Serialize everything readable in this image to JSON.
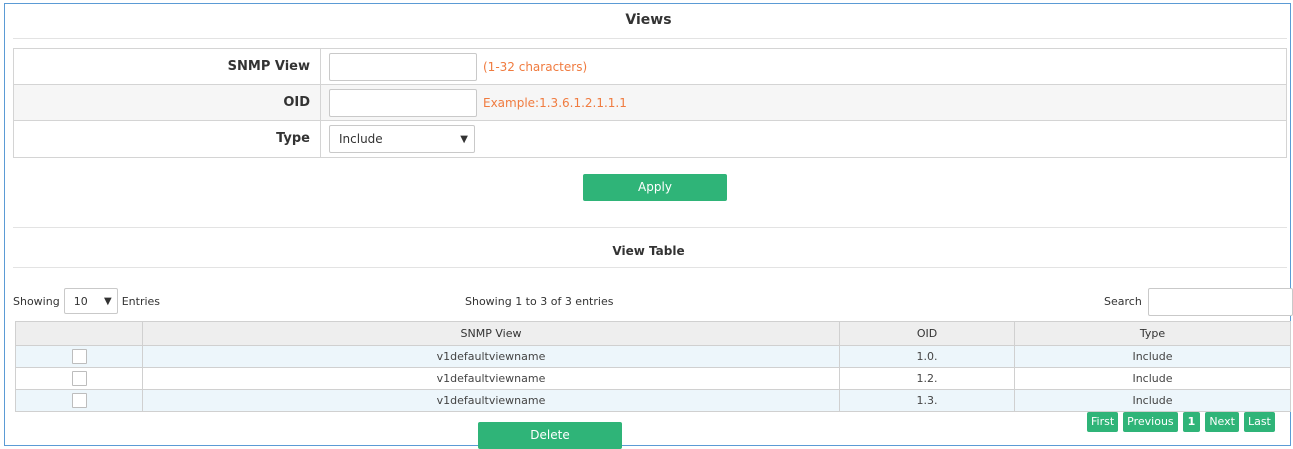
{
  "views": {
    "title": "Views",
    "form": {
      "snmp_view": {
        "label": "SNMP View",
        "value": "",
        "hint": "(1-32 characters)"
      },
      "oid": {
        "label": "OID",
        "value": "",
        "hint": "Example:1.3.6.1.2.1.1.1"
      },
      "type": {
        "label": "Type",
        "selected": "Include"
      }
    },
    "apply_label": "Apply"
  },
  "view_table": {
    "title": "View Table",
    "showing_label": "Showing",
    "page_size": "10",
    "entries_label": "Entries",
    "info": "Showing 1 to 3 of 3 entries",
    "search_label": "Search",
    "search_value": "",
    "columns": [
      "",
      "SNMP View",
      "OID",
      "Type"
    ],
    "rows": [
      {
        "snmp_view": "v1defaultviewname",
        "oid": "1.0.",
        "type": "Include"
      },
      {
        "snmp_view": "v1defaultviewname",
        "oid": "1.2.",
        "type": "Include"
      },
      {
        "snmp_view": "v1defaultviewname",
        "oid": "1.3.",
        "type": "Include"
      }
    ],
    "pagination": {
      "first": "First",
      "previous": "Previous",
      "current": "1",
      "next": "Next",
      "last": "Last"
    },
    "delete_label": "Delete"
  },
  "colors": {
    "accent": "#2fb478",
    "hint": "#f07b3f",
    "frame_border": "#5b9bd5"
  },
  "icons": {
    "select_arrow": "chevron-down-icon"
  }
}
